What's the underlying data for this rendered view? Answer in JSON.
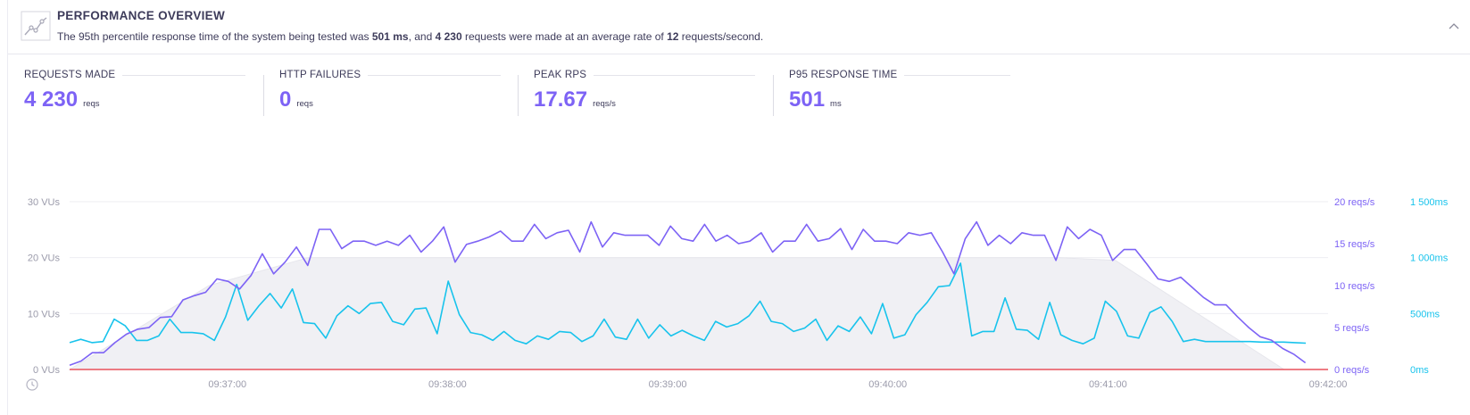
{
  "header": {
    "title": "PERFORMANCE OVERVIEW",
    "summary_pre": "The 95th percentile response time of the system being tested was ",
    "p95": "501 ms",
    "summary_mid": ", and ",
    "requests": "4 230",
    "summary_mid2": " requests were made at an average rate of ",
    "rate": "12",
    "summary_post": " requests/second."
  },
  "stats": [
    {
      "label": "REQUESTS MADE",
      "value": "4 230",
      "unit": "reqs"
    },
    {
      "label": "HTTP FAILURES",
      "value": "0",
      "unit": "reqs"
    },
    {
      "label": "PEAK RPS",
      "value": "17.67",
      "unit": "reqs/s"
    },
    {
      "label": "P95 RESPONSE TIME",
      "value": "501",
      "unit": "ms"
    }
  ],
  "colors": {
    "accent": "#7d63f5",
    "response": "#18c3ec",
    "vus_fill": "#f0f0f4",
    "failures": "#e8505b",
    "text": "#3d3b5a",
    "muted": "#9b9bab"
  },
  "chart_data": {
    "type": "line",
    "x_ticks": [
      "09:37:00",
      "09:38:00",
      "09:39:00",
      "09:40:00",
      "09:41:00",
      "09:42:00"
    ],
    "x_range": [
      "09:36:17",
      "09:42:00"
    ],
    "y_left": {
      "ticks": [
        "0 VUs",
        "10 VUs",
        "20 VUs",
        "30 VUs"
      ],
      "range": [
        0,
        30
      ]
    },
    "y_right_rps": {
      "ticks": [
        "0 reqs/s",
        "5 reqs/s",
        "10 reqs/s",
        "15 reqs/s",
        "20 reqs/s"
      ],
      "range": [
        0,
        20
      ]
    },
    "y_right_ms": {
      "ticks": [
        "0ms",
        "500ms",
        "1 000ms",
        "1 500ms"
      ],
      "range": [
        0,
        1500
      ]
    },
    "grid": true,
    "series": [
      {
        "axis": "vus",
        "type": "area",
        "points": [
          [
            0,
            0
          ],
          [
            38,
            15
          ],
          [
            65,
            20
          ],
          [
            270,
            20
          ],
          [
            285,
            19.5
          ],
          [
            331,
            0
          ]
        ]
      },
      {
        "axis": "rps",
        "values": [
          0.5,
          1.0,
          2.0,
          2.0,
          3.2,
          4.2,
          4.8,
          5.0,
          6.2,
          6.3,
          8.3,
          8.8,
          9.2,
          10.8,
          10.5,
          9.6,
          11.2,
          13.8,
          11.4,
          12.8,
          14.6,
          12.4,
          16.7,
          16.7,
          14.4,
          15.3,
          15.3,
          14.8,
          15.3,
          14.8,
          16.0,
          14.0,
          15.3,
          17.0,
          12.8,
          14.9,
          15.3,
          15.8,
          16.5,
          15.3,
          15.3,
          17.3,
          15.6,
          16.3,
          16.6,
          14.0,
          17.6,
          14.6,
          16.3,
          16.0,
          16.0,
          16.0,
          14.8,
          17.1,
          15.6,
          15.3,
          17.3,
          15.3,
          16.0,
          15.0,
          15.3,
          16.3,
          14.0,
          15.3,
          15.3,
          17.3,
          15.3,
          15.6,
          16.8,
          14.3,
          16.7,
          15.3,
          15.3,
          15.0,
          16.3,
          16.0,
          16.3,
          14.0,
          11.4,
          15.6,
          17.6,
          14.8,
          16.0,
          15.0,
          16.3,
          16.0,
          16.0,
          13.0,
          17.0,
          15.6,
          16.7,
          16.0,
          13.0,
          14.3,
          14.3,
          12.6,
          10.8,
          10.5,
          11.0,
          9.8,
          8.6,
          7.7,
          7.7,
          6.3,
          5.0,
          3.9,
          3.5,
          2.5,
          1.8,
          0.8
        ]
      },
      {
        "axis": "ms",
        "values": [
          240,
          270,
          240,
          250,
          450,
          390,
          260,
          260,
          300,
          450,
          330,
          330,
          320,
          260,
          470,
          760,
          440,
          570,
          680,
          550,
          720,
          420,
          410,
          280,
          480,
          570,
          500,
          590,
          600,
          430,
          400,
          540,
          550,
          320,
          790,
          490,
          330,
          310,
          260,
          340,
          260,
          230,
          300,
          270,
          340,
          330,
          250,
          300,
          450,
          290,
          270,
          450,
          280,
          400,
          300,
          350,
          300,
          260,
          430,
          380,
          410,
          480,
          610,
          430,
          410,
          340,
          370,
          450,
          260,
          390,
          340,
          470,
          320,
          590,
          280,
          310,
          490,
          600,
          740,
          750,
          950,
          300,
          340,
          340,
          640,
          360,
          350,
          270,
          600,
          310,
          260,
          230,
          280,
          610,
          520,
          300,
          280,
          510,
          560,
          430,
          250,
          270,
          250,
          250,
          250,
          250,
          250,
          245,
          245,
          245,
          240,
          235
        ]
      },
      {
        "axis": "rps",
        "name": "",
        "color_key": "failures",
        "values": [
          0,
          0
        ]
      }
    ]
  }
}
